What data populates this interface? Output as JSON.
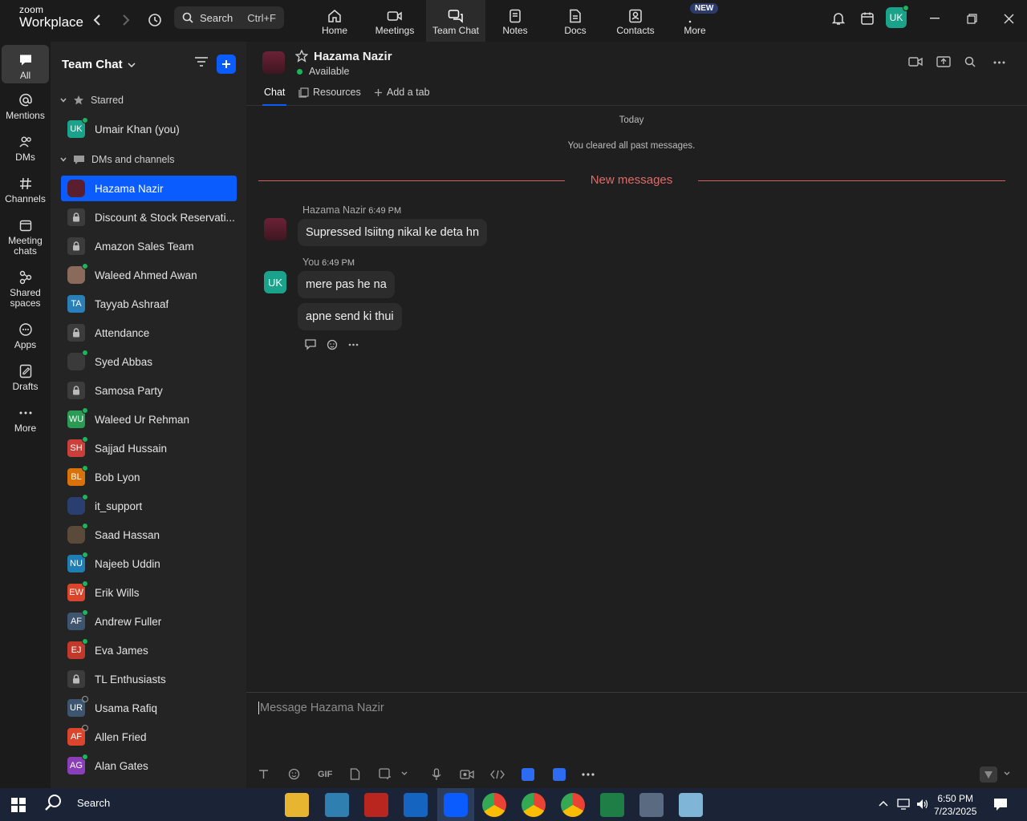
{
  "app": {
    "brand_top": "zoom",
    "brand_bottom": "Workplace"
  },
  "search": {
    "label": "Search",
    "shortcut": "Ctrl+F"
  },
  "top_tabs": [
    {
      "label": "Home",
      "icon": "home-icon"
    },
    {
      "label": "Meetings",
      "icon": "video-camera-icon"
    },
    {
      "label": "Team Chat",
      "icon": "chat-icon",
      "active": true
    },
    {
      "label": "Notes",
      "icon": "notes-icon"
    },
    {
      "label": "Docs",
      "icon": "docs-icon"
    },
    {
      "label": "Contacts",
      "icon": "contacts-icon"
    },
    {
      "label": "More",
      "icon": "more-icon",
      "badge": "NEW"
    }
  ],
  "user_avatar": "UK",
  "rail": [
    {
      "label": "All",
      "icon": "chat-bubble-icon",
      "active": true
    },
    {
      "label": "Mentions",
      "icon": "at-icon"
    },
    {
      "label": "DMs",
      "icon": "people-icon"
    },
    {
      "label": "Channels",
      "icon": "hash-icon"
    },
    {
      "label": "Meeting chats",
      "icon": "calendar-icon"
    },
    {
      "label": "Shared spaces",
      "icon": "shared-icon"
    },
    {
      "label": "Apps",
      "icon": "apps-icon"
    },
    {
      "label": "Drafts",
      "icon": "drafts-icon"
    },
    {
      "label": "More",
      "icon": "ellipsis-icon"
    }
  ],
  "sidebar": {
    "title": "Team Chat",
    "starred_label": "Starred",
    "starred": [
      {
        "name": "Umair Khan (you)",
        "initials": "UK",
        "color": "#1aa38a",
        "status": "online"
      }
    ],
    "dms_label": "DMs and channels",
    "items": [
      {
        "name": "Hazama Nazir",
        "type": "photo",
        "color": "#5a1e2e",
        "active": true
      },
      {
        "name": "Discount & Stock Reservati...",
        "type": "lock"
      },
      {
        "name": "Amazon Sales Team",
        "type": "lock"
      },
      {
        "name": "Waleed Ahmed Awan",
        "type": "photo",
        "color": "#8a6a5a",
        "status": "online"
      },
      {
        "name": "Tayyab Ashraaf",
        "initials": "TA",
        "color": "#2a7fb8"
      },
      {
        "name": "Attendance",
        "type": "lock"
      },
      {
        "name": "Syed Abbas",
        "type": "photo",
        "color": "#3a3a3a",
        "status": "online"
      },
      {
        "name": "Samosa Party",
        "type": "lock"
      },
      {
        "name": "Waleed Ur Rehman",
        "initials": "WU",
        "color": "#2b9a54",
        "status": "online"
      },
      {
        "name": "Sajjad Hussain",
        "initials": "SH",
        "color": "#c9403a",
        "status": "online"
      },
      {
        "name": "Bob Lyon",
        "initials": "BL",
        "color": "#d9720b",
        "status": "online"
      },
      {
        "name": "it_support",
        "type": "photo",
        "color": "#2a3f70",
        "status": "online"
      },
      {
        "name": "Saad Hassan",
        "type": "photo",
        "color": "#5b4a3a",
        "status": "online"
      },
      {
        "name": "Najeeb Uddin",
        "initials": "NU",
        "color": "#1f7fb5",
        "status": "online"
      },
      {
        "name": "Erik Wills",
        "initials": "EW",
        "color": "#d9462c",
        "status": "online"
      },
      {
        "name": "Andrew Fuller",
        "initials": "AF",
        "color": "#3e5570",
        "status": "online"
      },
      {
        "name": "Eva James",
        "initials": "EJ",
        "color": "#c0392b",
        "status": "online"
      },
      {
        "name": "TL Enthusiasts",
        "type": "lock"
      },
      {
        "name": "Usama Rafiq",
        "initials": "UR",
        "color": "#3e5570",
        "status": "offline"
      },
      {
        "name": "Allen Fried",
        "initials": "AF",
        "color": "#d9462c",
        "status": "offline"
      },
      {
        "name": "Alan Gates",
        "initials": "AG",
        "color": "#8a3fb8",
        "status": "online"
      }
    ]
  },
  "chat": {
    "contact_name": "Hazama Nazir",
    "status": "Available",
    "tabs": [
      "Chat",
      "Resources",
      "Add a tab"
    ],
    "day_label": "Today",
    "cleared_note": "You cleared all past messages.",
    "new_messages_label": "New messages",
    "messages": [
      {
        "sender": "Hazama Nazir",
        "time": "6:49 PM",
        "texts": [
          "Supressed lsiitng nikal ke deta hn"
        ]
      },
      {
        "sender": "You",
        "time": "6:49 PM",
        "avatar": "UK",
        "texts": [
          "mere pas he na",
          "apne send ki thui"
        ]
      }
    ],
    "composer_placeholder": "Message Hazama Nazir",
    "gif_label": "GIF"
  },
  "taskbar": {
    "search_label": "Search",
    "time": "6:50 PM",
    "date": "7/23/2025"
  }
}
